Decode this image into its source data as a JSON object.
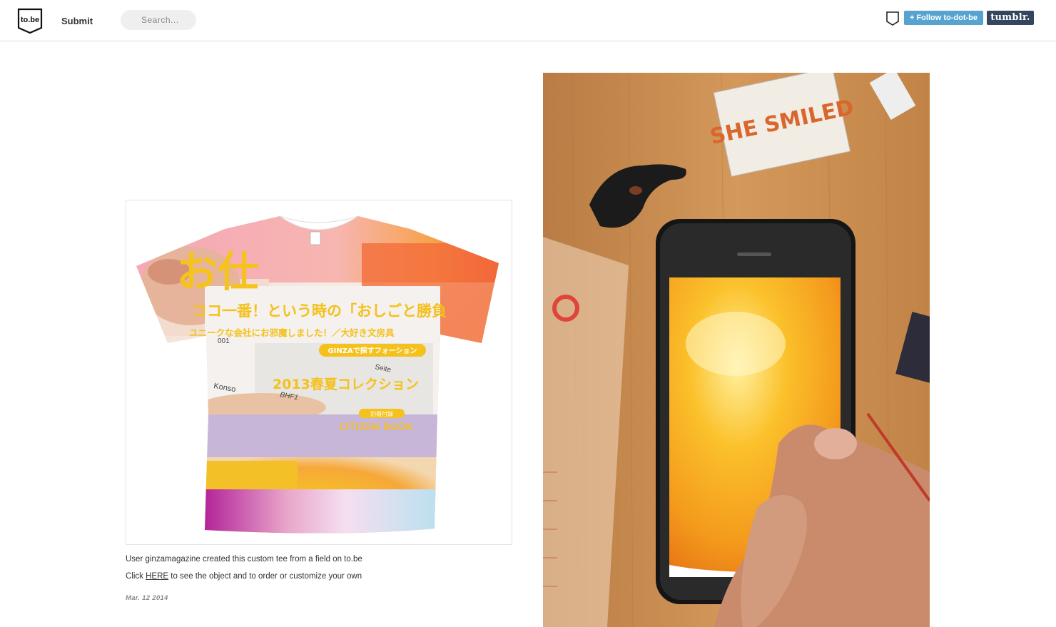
{
  "header": {
    "logo_text": "to.be",
    "submit_label": "Submit",
    "search_placeholder": "Search...",
    "follow_label": "+ Follow to-dot-be",
    "tumblr_label": "tumblr."
  },
  "post_left": {
    "shirt_text": {
      "headline": "お仕",
      "line1": "ココ一番！という時の「おしごと勝負",
      "line2": "ユニークな会社にお邪魔しました！／大好き文房具",
      "badge": "GINZAで探すフォーション",
      "line3": "2013春夏コレクション",
      "small_badge": "別冊付録",
      "line4": "CITIZEN BOOK",
      "card_a": "Konso",
      "card_b": "BHF1",
      "card_c": "Seite",
      "card_d": "001"
    },
    "caption_line1": "User ginzamagazine created this custom tee from a field on to.be",
    "caption_line2_before": "Click ",
    "caption_link": "HERE",
    "caption_line2_after": " to see the object and to order or customize your own",
    "date": "Mar. 12 2014"
  },
  "post_right": {
    "box_text": "SHE SMILED"
  },
  "colors": {
    "follow_button": "#56a3d0",
    "tumblr_button": "#34465d",
    "shirt_yellow": "#f7c51e",
    "shirt_magenta": "#b3249a",
    "table_wood": "#c8874a"
  }
}
